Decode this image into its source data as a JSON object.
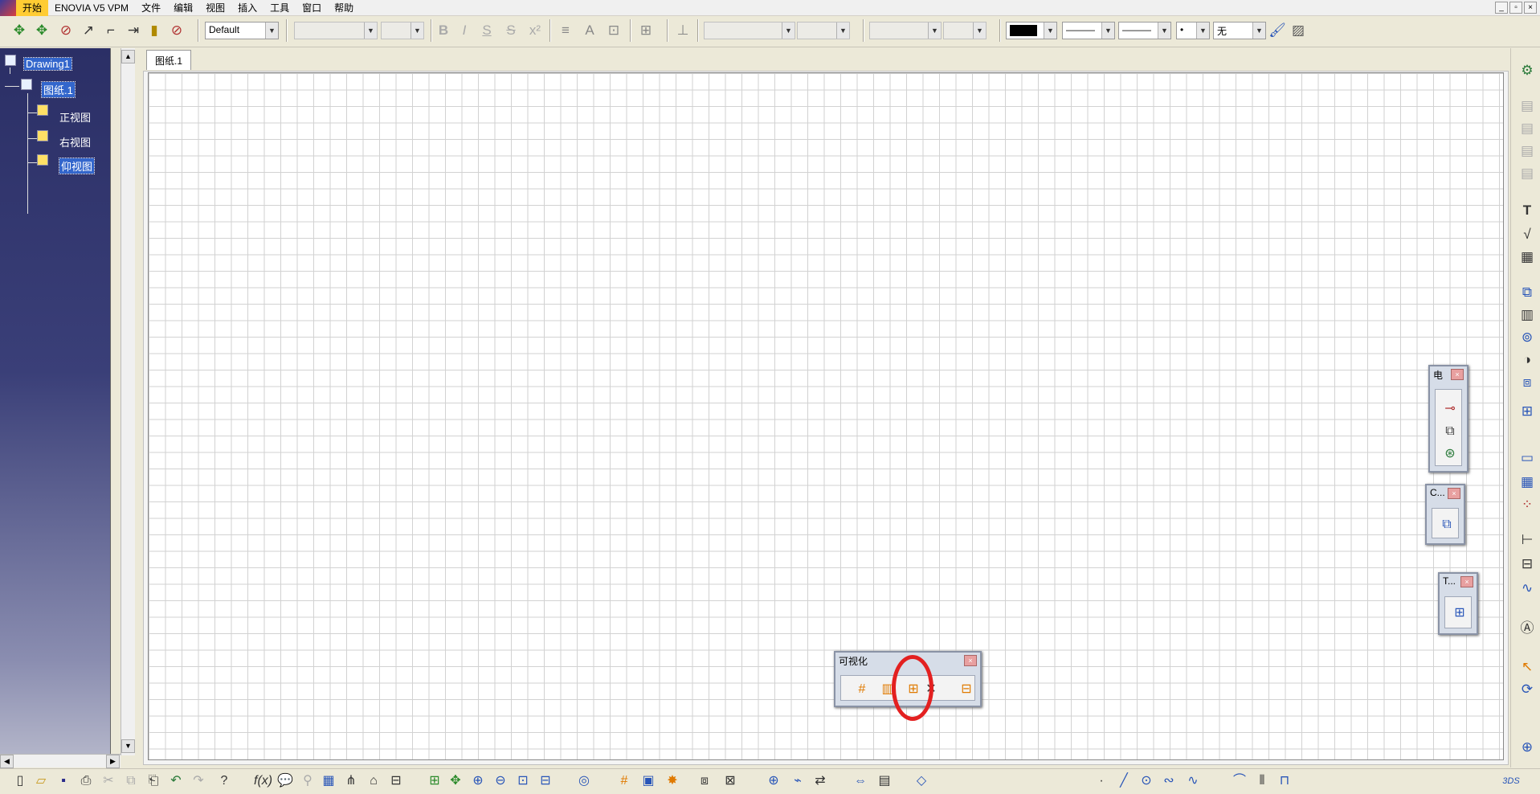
{
  "menu": {
    "items": [
      "开始",
      "ENOVIA V5 VPM",
      "文件",
      "编辑",
      "视图",
      "插入",
      "工具",
      "窗口",
      "帮助"
    ],
    "active_index": 0
  },
  "window_controls": {
    "minimize": "_",
    "restore": "▫",
    "close": "×"
  },
  "toolbar": {
    "style_combo": "Default",
    "color_swatch": "#000000",
    "line_style_combo": "———",
    "line_weight_combo": "———",
    "point_combo": "•",
    "pattern_combo": "无"
  },
  "tree": {
    "root": "Drawing1",
    "sheet": "图纸.1",
    "views": [
      "正视图",
      "右视图",
      "仰视图"
    ]
  },
  "sheet_tab": "图纸.1",
  "palettes": {
    "visualization": {
      "title": "可视化",
      "close": "×"
    },
    "electrical": {
      "title": "电",
      "close": "×"
    },
    "c_palette": {
      "title": "C...",
      "close": "×"
    },
    "t_palette": {
      "title": "T...",
      "close": "×"
    }
  },
  "colors": {
    "tree_bg": "#2b2f66",
    "highlight_circle": "#e32020",
    "menu_active": "#ffcc33"
  }
}
